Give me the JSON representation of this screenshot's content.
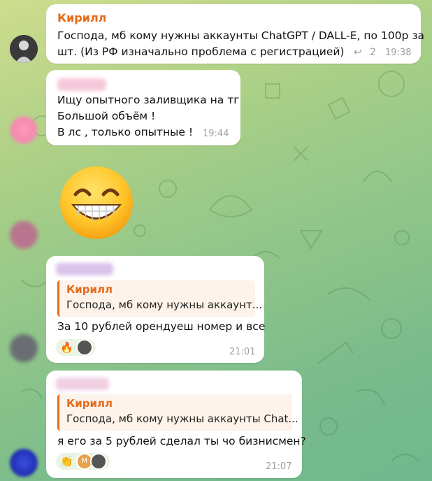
{
  "messages": [
    {
      "sender": "Кирилл",
      "text_lines": [
        "Господа, мб кому нужны аккаунты ChatGPT / DALL-E, по 100р за",
        "шт. (Из РФ изначально проблема с регистрацией)"
      ],
      "reply_count": "2",
      "time": "19:38"
    },
    {
      "text_lines": [
        "Ищу опытного заливщика на тг",
        "Большой объём !",
        "В лс , только опытные !"
      ],
      "time": "19:44"
    },
    {
      "sticker": "grinning-emoji"
    },
    {
      "reply_to": {
        "sender": "Кирилл",
        "text": "Господа, мб кому нужны аккаунт..."
      },
      "text": "За 10 рублей орендуеш номер и все",
      "reactions": [
        "🔥"
      ],
      "time": "21:01"
    },
    {
      "reply_to": {
        "sender": "Кирилл",
        "text": "Господа, мб кому нужны аккаунты Chat..."
      },
      "text": "я его за 5 рублей сделал ты чо бизнисмен?",
      "reactions": [
        "👏"
      ],
      "reaction_avatar_letter": "М",
      "time": "21:07"
    }
  ],
  "colors": {
    "accent_name": "#e56b1a",
    "bubble": "#ffffff",
    "time": "#9aa29a"
  }
}
